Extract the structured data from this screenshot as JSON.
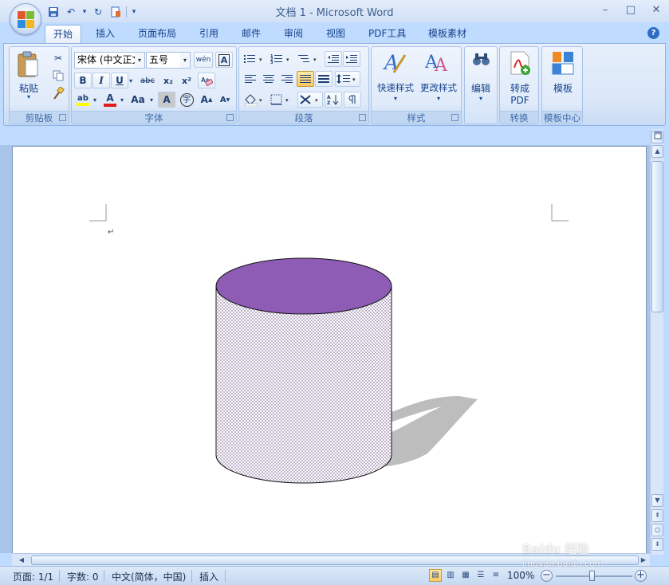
{
  "window": {
    "title": "文档 1 - Microsoft Word",
    "controls": [
      "–",
      "□",
      "✕"
    ]
  },
  "qat": {
    "undo_glyph": "↶",
    "redo_glyph": "↻",
    "more": "▾"
  },
  "tabs": [
    "开始",
    "插入",
    "页面布局",
    "引用",
    "邮件",
    "审阅",
    "视图",
    "PDF工具",
    "模板素材"
  ],
  "active_tab": "开始",
  "ribbon": {
    "clipboard": {
      "label": "剪贴板",
      "paste": "粘贴"
    },
    "font": {
      "label": "字体",
      "font_name": "宋体 (中文正文",
      "font_size": "五号",
      "phonetic": "wén",
      "bold": "B",
      "italic": "I",
      "underline": "U",
      "strike": "abc",
      "subscript": "x₂",
      "superscript": "x²",
      "highlight": "ab",
      "font_color": "A",
      "change_case": "Aa",
      "char_shading": "A",
      "enclose": "字",
      "grow": "A",
      "shrink": "A"
    },
    "paragraph": {
      "label": "段落"
    },
    "styles": {
      "label": "样式",
      "quick_styles": "快速样式",
      "change_styles": "更改样式"
    },
    "editing": {
      "label": "编辑"
    },
    "convert": {
      "label": "转换",
      "to_pdf_line1": "转成",
      "to_pdf_line2": "PDF"
    },
    "template": {
      "label": "模板中心",
      "template": "模板"
    }
  },
  "document": {
    "para_mark": "↵",
    "shape": {
      "type": "can",
      "top_color": "#8e5cb5",
      "body_pattern": "dotted",
      "shadow_color": "#bdbdbd"
    }
  },
  "status": {
    "page": "页面: 1/1",
    "words": "字数: 0",
    "language": "中文(简体，中国)",
    "mode": "插入",
    "zoom": "100%",
    "zoom_level": 1.0
  },
  "watermark": {
    "text": "Baidu 经验",
    "url": "jingyan.baidu.com"
  }
}
